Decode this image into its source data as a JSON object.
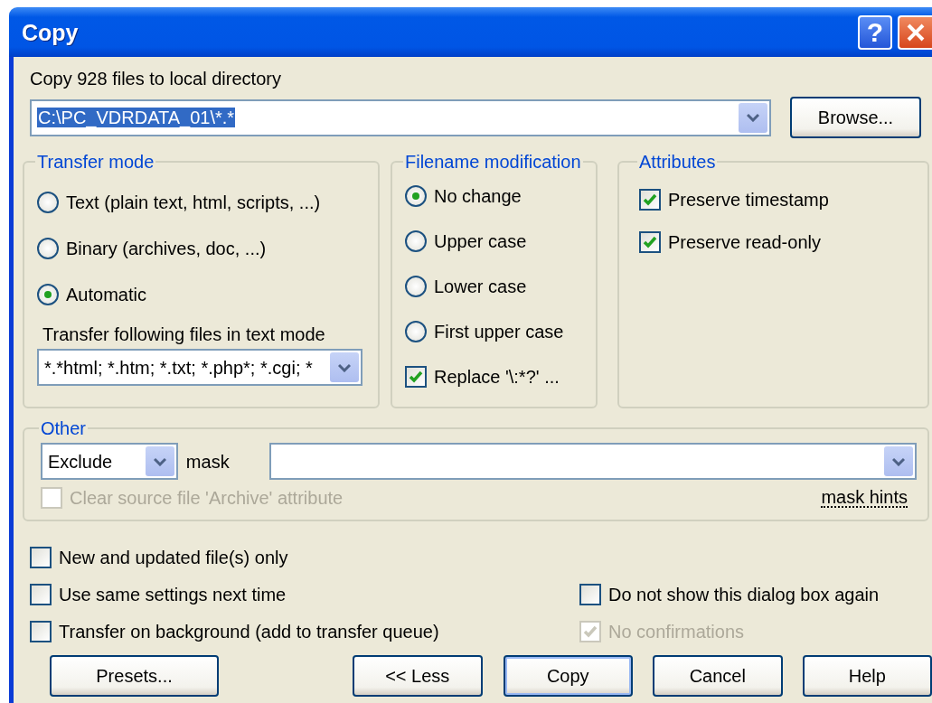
{
  "window": {
    "title": "Copy"
  },
  "title_buttons": [
    {
      "kind": "help",
      "label": "?"
    },
    {
      "kind": "close"
    }
  ],
  "destination": {
    "label": "Copy 928 files to local directory",
    "value": "C:\\PC_VDRDATA_01\\*.*",
    "text_selected": true
  },
  "browse_button": "Browse...",
  "transfer_mode": {
    "title": "Transfer mode",
    "options": [
      {
        "label": "Text (plain text, html, scripts, ...)",
        "selected": false
      },
      {
        "label": "Binary (archives, doc, ...)",
        "selected": false
      },
      {
        "label": "Automatic",
        "selected": true
      }
    ],
    "text_mode_label": "Transfer following files in text mode",
    "text_mode_value": "*.*html; *.htm; *.txt; *.php*; *.cgi; *"
  },
  "filename_modification": {
    "title": "Filename modification",
    "options": [
      {
        "label": "No change",
        "selected": true
      },
      {
        "label": "Upper case",
        "selected": false
      },
      {
        "label": "Lower case",
        "selected": false
      },
      {
        "label": "First upper case",
        "selected": false
      }
    ],
    "replace": {
      "label": "Replace '\\:*?' ...",
      "checked": true
    }
  },
  "attributes": {
    "title": "Attributes",
    "items": [
      {
        "label": "Preserve timestamp",
        "checked": true
      },
      {
        "label": "Preserve read-only",
        "checked": true
      }
    ]
  },
  "other": {
    "title": "Other",
    "filter_value": "Exclude",
    "mask_label": "mask",
    "clear_archive": {
      "label": "Clear source file 'Archive' attribute",
      "checked": false,
      "disabled": true
    },
    "mask_hints": "mask hints"
  },
  "options_left": [
    {
      "label": "New and updated file(s) only",
      "checked": false,
      "disabled": false
    },
    {
      "label": "Use same settings next time",
      "checked": false,
      "disabled": false
    },
    {
      "label": "Transfer on background (add to transfer queue)",
      "checked": false,
      "disabled": false
    }
  ],
  "options_right": [
    {
      "label": "Do not show this dialog box again",
      "checked": false,
      "disabled": false
    },
    {
      "label": "No confirmations",
      "checked": true,
      "disabled": true
    }
  ],
  "buttons": [
    {
      "label": "Presets...",
      "default": false
    },
    {
      "label": "<< Less",
      "default": false
    },
    {
      "label": "Copy",
      "default": true
    },
    {
      "label": "Cancel",
      "default": false
    },
    {
      "label": "Help",
      "default": false
    }
  ]
}
